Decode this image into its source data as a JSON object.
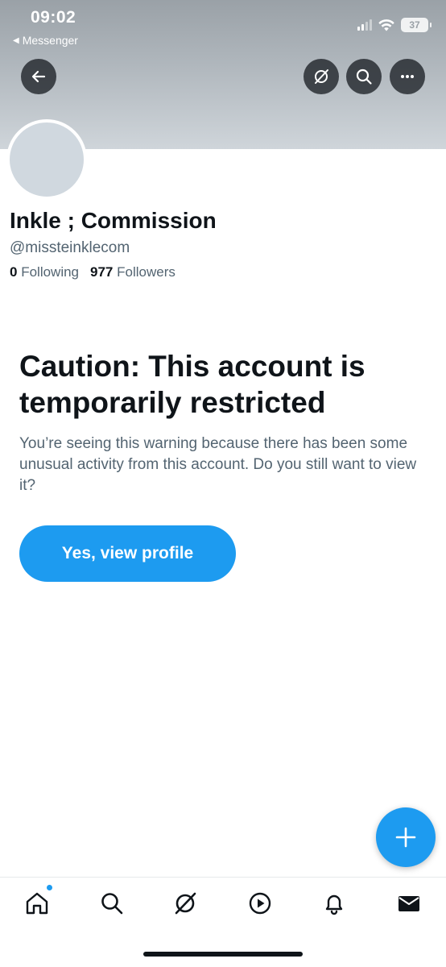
{
  "status_bar": {
    "time": "09:02",
    "back_app": "Messenger",
    "back_arrow": "◀",
    "battery": "37"
  },
  "header": {
    "icons": [
      "back-arrow-icon",
      "grok-icon",
      "search-icon",
      "more-icon"
    ]
  },
  "profile": {
    "display_name": "Inkle ; Commission",
    "handle": "@missteinklecom",
    "following_count": "0",
    "following_label": "Following",
    "followers_count": "977",
    "followers_label": "Followers"
  },
  "warning": {
    "title": "Caution: This account is temporarily restricted",
    "body": "You’re seeing this warning because there has been some unusual activity from this account. Do you still want to view it?",
    "button_label": "Yes, view profile"
  },
  "colors": {
    "accent": "#1d9bf0",
    "text_primary": "#0f1419",
    "text_secondary": "#536471"
  },
  "tab_bar": {
    "tabs": [
      "home-icon",
      "search-icon",
      "grok-icon",
      "video-icon",
      "notifications-icon",
      "messages-icon"
    ],
    "home_has_badge": true
  }
}
